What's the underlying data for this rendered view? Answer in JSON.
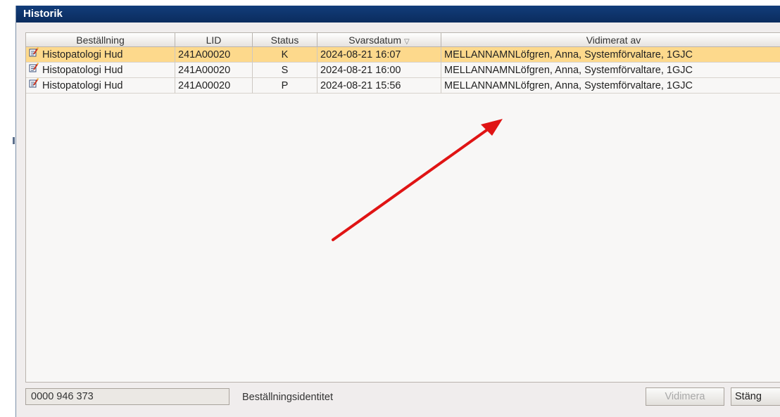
{
  "window": {
    "title": "Historik"
  },
  "table": {
    "columns": [
      "Beställning",
      "LID",
      "Status",
      "Svarsdatum",
      "Vidimerat av"
    ],
    "sort_column": "Svarsdatum",
    "rows": [
      {
        "bestallning": "Histopatologi Hud",
        "lid": "241A00020",
        "status": "K",
        "svarsdatum": "2024-08-21 16:07",
        "vidimerat_av": "MELLANNAMNLöfgren, Anna, Systemförvaltare, 1GJC",
        "selected": true
      },
      {
        "bestallning": "Histopatologi Hud",
        "lid": "241A00020",
        "status": "S",
        "svarsdatum": "2024-08-21 16:00",
        "vidimerat_av": "MELLANNAMNLöfgren, Anna, Systemförvaltare, 1GJC",
        "selected": false
      },
      {
        "bestallning": "Histopatologi Hud",
        "lid": "241A00020",
        "status": "P",
        "svarsdatum": "2024-08-21 15:56",
        "vidimerat_av": "MELLANNAMNLöfgren, Anna, Systemförvaltare, 1GJC",
        "selected": false
      }
    ],
    "row_icon": "document-edit-icon"
  },
  "footer": {
    "identity_value": "0000 946 373",
    "identity_label": "Beställningsidentitet",
    "vidimera_label": "Vidimera",
    "stang_label": "Stäng"
  },
  "colors": {
    "titlebar": "#0b2c5e",
    "selected_row": "#fdd98c",
    "arrow": "#e01414"
  }
}
